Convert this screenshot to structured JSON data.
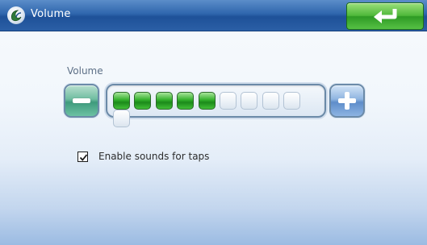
{
  "window": {
    "title": "Volume"
  },
  "header": {
    "back_icon": "return-arrow-icon",
    "app_icon": "app-logo-icon"
  },
  "volume": {
    "label": "Volume",
    "level": 5,
    "max": 10,
    "minus_icon": "minus-icon",
    "plus_icon": "plus-icon"
  },
  "options": {
    "tap_sounds": {
      "label": "Enable sounds for taps",
      "checked": true
    }
  },
  "colors": {
    "title_bar": "#2f66ad",
    "back_button": "#4fb83a",
    "volume_on": "#33b02c",
    "volume_off": "#eef3f8"
  }
}
